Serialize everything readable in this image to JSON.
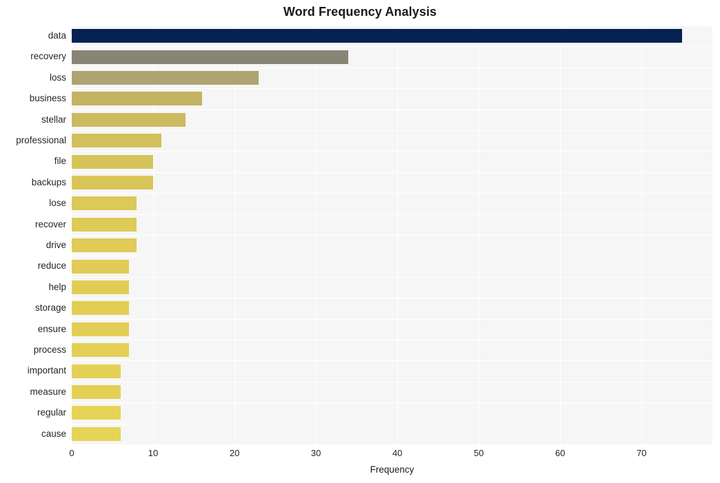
{
  "chart_data": {
    "type": "bar",
    "orientation": "horizontal",
    "title": "Word Frequency Analysis",
    "xlabel": "Frequency",
    "ylabel": "",
    "categories": [
      "data",
      "recovery",
      "loss",
      "business",
      "stellar",
      "professional",
      "file",
      "backups",
      "lose",
      "recover",
      "drive",
      "reduce",
      "help",
      "storage",
      "ensure",
      "process",
      "important",
      "measure",
      "regular",
      "cause"
    ],
    "values": [
      75,
      34,
      23,
      16,
      14,
      11,
      10,
      10,
      8,
      8,
      8,
      7,
      7,
      7,
      7,
      7,
      6,
      6,
      6,
      6
    ],
    "bar_colors": [
      "#052253",
      "#888577",
      "#ada470",
      "#c3b363",
      "#cbba5f",
      "#d2c05c",
      "#d6c45a",
      "#d9c659",
      "#dcc957",
      "#ddca57",
      "#dfcb56",
      "#e0cc56",
      "#e1cd56",
      "#e2ce55",
      "#e2ce55",
      "#e3cf55",
      "#e4d055",
      "#e4d055",
      "#e5d455",
      "#e5d455"
    ],
    "xlim": [
      0,
      78.7
    ],
    "ylim_note": "categorical, descending frequency",
    "xticks": [
      0,
      10,
      20,
      30,
      40,
      50,
      60,
      70
    ],
    "xtick_labels": [
      "0",
      "10",
      "20",
      "30",
      "40",
      "50",
      "60",
      "70"
    ],
    "grid": true,
    "grid_color": "#ffffff",
    "plot_background": "#f6f6f6",
    "figure_background": "#ffffff",
    "legend": null
  }
}
